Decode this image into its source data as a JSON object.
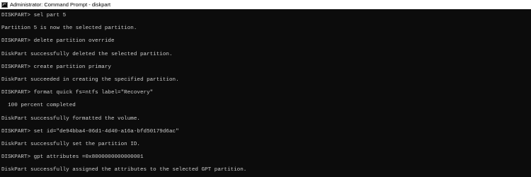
{
  "window": {
    "title": "Administrator: Command Prompt - diskpart",
    "icon": "command-prompt-icon"
  },
  "console": {
    "lines": [
      "DISKPART> sel part 5",
      "Partition 5 is now the selected partition.",
      "DISKPART> delete partition override",
      "DiskPart successfully deleted the selected partition.",
      "DISKPART> create partition primary",
      "DiskPart succeeded in creating the specified partition.",
      "DISKPART> format quick fs=ntfs label=\"Recovery\"",
      "  100 percent completed",
      "DiskPart successfully formatted the volume.",
      "DISKPART> set id=\"de94bba4-06d1-4d40-a16a-bfd50179d6ac\"",
      "DiskPart successfully set the partition ID.",
      "DISKPART> gpt attributes =0x8000000000000001",
      "DiskPart successfully assigned the attributes to the selected GPT partition."
    ]
  },
  "colors": {
    "background": "#0c0c0c",
    "text": "#cccccc",
    "titlebar": "#ffffff"
  }
}
